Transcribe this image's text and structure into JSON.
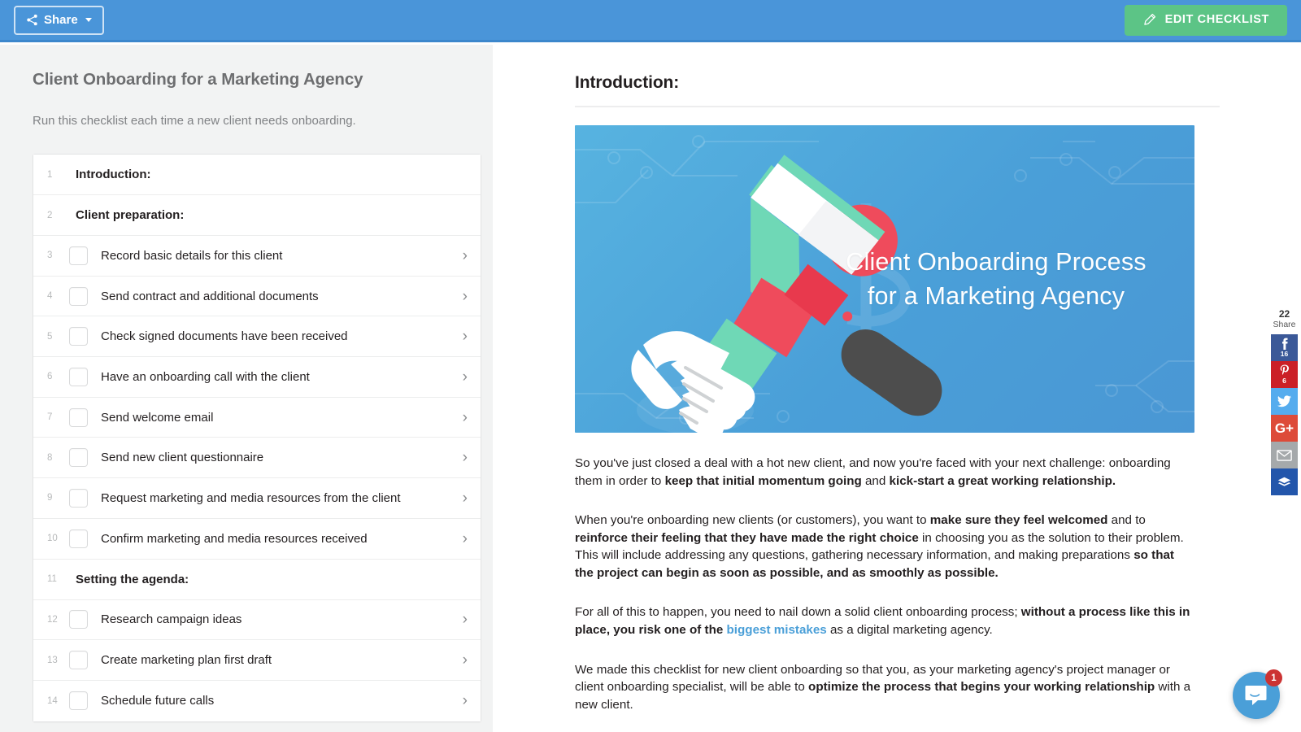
{
  "topbar": {
    "share_label": "Share",
    "edit_label": "EDIT CHECKLIST",
    "bg_color": "#4a95d9",
    "edit_color": "#5cc486"
  },
  "sidebar": {
    "title": "Client Onboarding for a Marketing Agency",
    "description": "Run this checklist each time a new client needs onboarding.",
    "items": [
      {
        "num": "1",
        "label": "Introduction:",
        "type": "header"
      },
      {
        "num": "2",
        "label": "Client preparation:",
        "type": "header"
      },
      {
        "num": "3",
        "label": "Record basic details for this client",
        "type": "task"
      },
      {
        "num": "4",
        "label": "Send contract and additional documents",
        "type": "task"
      },
      {
        "num": "5",
        "label": "Check signed documents have been received",
        "type": "task"
      },
      {
        "num": "6",
        "label": "Have an onboarding call with the client",
        "type": "task"
      },
      {
        "num": "7",
        "label": "Send welcome email",
        "type": "task"
      },
      {
        "num": "8",
        "label": "Send new client questionnaire",
        "type": "task"
      },
      {
        "num": "9",
        "label": "Request marketing and media resources from the client",
        "type": "task"
      },
      {
        "num": "10",
        "label": "Confirm marketing and media resources received",
        "type": "task"
      },
      {
        "num": "11",
        "label": "Setting the agenda:",
        "type": "header"
      },
      {
        "num": "12",
        "label": "Research campaign ideas",
        "type": "task"
      },
      {
        "num": "13",
        "label": "Create marketing plan first draft",
        "type": "task"
      },
      {
        "num": "14",
        "label": "Schedule future calls",
        "type": "task"
      }
    ]
  },
  "main": {
    "heading": "Introduction:",
    "hero": {
      "line1": "Client Onboarding Process",
      "line2": "for a Marketing Agency",
      "bg_color": "#4a9fd8"
    },
    "paragraphs": {
      "p1_a": "So you've just closed a deal with a hot new client, and now you're faced with your next challenge: onboarding them in order to ",
      "p1_b": "keep that initial momentum going",
      "p1_c": " and ",
      "p1_d": "kick-start a great working relationship.",
      "p2_a": "When you're onboarding new clients (or customers), you want to ",
      "p2_b": "make sure they feel welcomed",
      "p2_c": " and to ",
      "p2_d": "reinforce their feeling that they have made the right choice",
      "p2_e": " in choosing you as the solution to their problem. This will include addressing any questions, gathering necessary information, and making preparations ",
      "p2_f": "so that the project can begin as soon as possible, and as smoothly as possible.",
      "p3_a": "For all of this to happen, you need to nail down a solid client onboarding process; ",
      "p3_b": "without a process like this in place, you risk one of the ",
      "p3_link": "biggest mistakes",
      "p3_c": " as a digital marketing agency.",
      "p4_a": "We made this checklist for new client onboarding so that you, as your marketing agency's project manager or client onboarding specialist, will be able to ",
      "p4_b": "optimize the process that begins your working relationship",
      "p4_c": " with a new client."
    }
  },
  "social": {
    "total_count": "22",
    "share_label": "Share",
    "buttons": [
      {
        "network": "facebook",
        "glyph": "f",
        "count": "16",
        "color": "#3b5998"
      },
      {
        "network": "pinterest",
        "glyph": "P",
        "count": "6",
        "color": "#cb2027"
      },
      {
        "network": "twitter",
        "glyph": "t",
        "count": "",
        "color": "#55acee"
      },
      {
        "network": "googleplus",
        "glyph": "G+",
        "count": "",
        "color": "#dd4b39"
      },
      {
        "network": "email",
        "glyph": "@",
        "count": "",
        "color": "#a5a9ab"
      },
      {
        "network": "buffer",
        "glyph": "B",
        "count": "",
        "color": "#2356ab"
      }
    ]
  },
  "chat": {
    "badge_count": "1",
    "color": "#4a9fd8"
  }
}
